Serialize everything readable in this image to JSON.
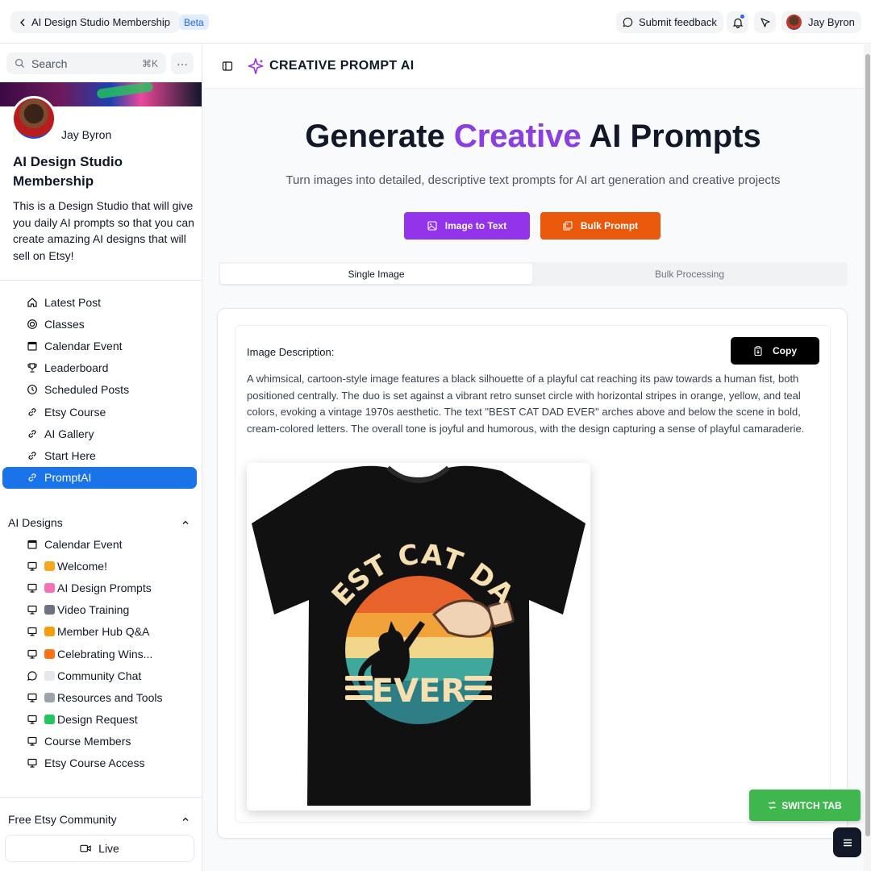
{
  "topbar": {
    "back_label": "AI Design Studio Membership",
    "beta_label": "Beta",
    "feedback_label": "Submit feedback",
    "user_name": "Jay Byron"
  },
  "sidebar": {
    "search_placeholder": "Search",
    "search_shortcut": "⌘K",
    "more_label": "···",
    "profile_name": "Jay Byron",
    "community_title": "AI Design Studio Membership",
    "community_desc": "This is a Design Studio that will give you daily AI prompts so that you can create amazing AI designs that will sell on Etsy!",
    "main_items": [
      {
        "label": "Latest Post",
        "icon": "home-icon"
      },
      {
        "label": "Classes",
        "icon": "target-icon"
      },
      {
        "label": "Calendar Event",
        "icon": "calendar-icon"
      },
      {
        "label": "Leaderboard",
        "icon": "trophy-icon"
      },
      {
        "label": "Scheduled Posts",
        "icon": "clock-icon"
      },
      {
        "label": "Etsy Course",
        "icon": "link-icon"
      },
      {
        "label": "AI Gallery",
        "icon": "link-icon"
      },
      {
        "label": "Start Here",
        "icon": "link-icon"
      },
      {
        "label": "PromptAI",
        "icon": "link-icon",
        "active": true
      }
    ],
    "section_ai_designs": "AI Designs",
    "ai_design_items": [
      {
        "label": "Calendar Event",
        "icon": "calendar-icon",
        "emoji_color": ""
      },
      {
        "label": "Welcome!",
        "icon": "monitor-icon",
        "emoji_color": "#f5a623"
      },
      {
        "label": "AI Design Prompts",
        "icon": "monitor-icon",
        "emoji_color": "#f472b6"
      },
      {
        "label": "Video Training",
        "icon": "monitor-icon",
        "emoji_color": "#6b7280"
      },
      {
        "label": "Member Hub Q&A",
        "icon": "monitor-icon",
        "emoji_color": "#f59e0b"
      },
      {
        "label": "Celebrating Wins...",
        "icon": "monitor-icon",
        "emoji_color": "#f97316"
      },
      {
        "label": "Community Chat",
        "icon": "chat-icon",
        "emoji_color": "#e5e7eb"
      },
      {
        "label": "Resources and Tools",
        "icon": "monitor-icon",
        "emoji_color": "#9ca3af"
      },
      {
        "label": "Design Request",
        "icon": "monitor-icon",
        "emoji_color": "#22c55e"
      },
      {
        "label": "Course Members",
        "icon": "monitor-icon",
        "emoji_color": ""
      },
      {
        "label": "Etsy Course Access",
        "icon": "monitor-icon",
        "emoji_color": ""
      }
    ],
    "section_free_etsy": "Free Etsy Community",
    "live_label": "Live"
  },
  "main": {
    "brand": "CREATIVE PROMPT AI",
    "hero_title_part1": "Generate ",
    "hero_title_accent": "Creative",
    "hero_title_part2": " AI Prompts",
    "hero_subtitle": "Turn images into detailed, descriptive text prompts for AI art generation and creative projects",
    "btn_image_to_text": "Image to Text",
    "btn_bulk_prompt": "Bulk Prompt",
    "tab_single": "Single Image",
    "tab_bulk": "Bulk Processing",
    "description_label": "Image Description:",
    "copy_label": "Copy",
    "description_text": "A whimsical, cartoon-style image features a black silhouette of a playful cat reaching its paw towards a human fist, both positioned centrally. The duo is set against a vibrant retro sunset circle with horizontal stripes in orange, yellow, and teal colors, evoking a vintage 1970s aesthetic. The text \"BEST CAT DAD EVER\" arches above and below the scene in bold, cream-colored letters. The overall tone is joyful and humorous, with the design capturing a sense of playful camaraderie.",
    "shirt_text_top": "BEST CAT DAD",
    "shirt_text_bottom": "EVER"
  },
  "switch_tab_label": "SWITCH TAB",
  "colors": {
    "accent_purple": "#9333ea",
    "accent_orange": "#ea580c",
    "active_blue": "#1a73e8",
    "switch_green": "#3fb64e"
  }
}
